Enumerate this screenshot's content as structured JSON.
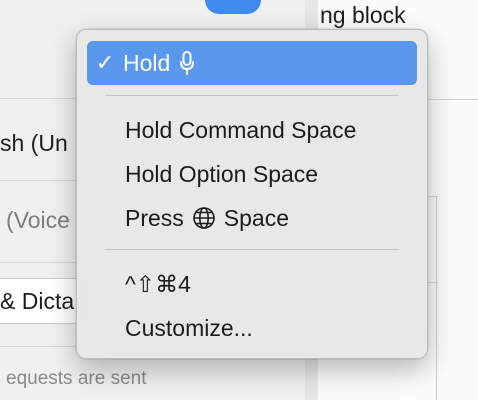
{
  "background": {
    "text_top_right": "ng block",
    "text_row1": "sh (Un",
    "text_row2": "(Voice",
    "text_row3": "& Dicta",
    "text_bottom": "equests are sent",
    "toggle_color": "#3f8cf0"
  },
  "menu": {
    "items": [
      {
        "label": "Hold",
        "checked": true,
        "check_mark": "✓",
        "icon": "microphone-icon"
      },
      {
        "label": "Hold Command Space"
      },
      {
        "label": "Hold Option Space"
      },
      {
        "label_prefix": "Press",
        "label_suffix": "Space",
        "icon": "globe-icon"
      },
      {
        "label": "^⇧⌘4"
      },
      {
        "label": "Customize..."
      }
    ],
    "selected_color": "#5a98ee"
  }
}
